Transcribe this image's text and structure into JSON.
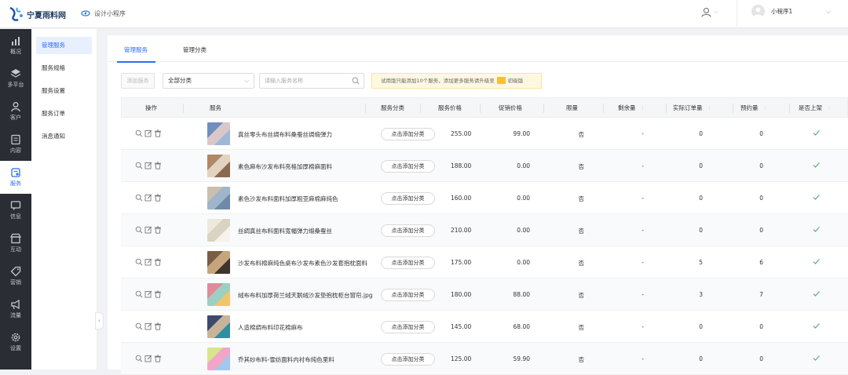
{
  "header": {
    "logo_text": "宁夏雨料网",
    "design_link": "设计小程序",
    "account_name": "小程序1"
  },
  "leftnav": [
    {
      "label": "概况",
      "icon": "chart-icon"
    },
    {
      "label": "多平台",
      "icon": "layers-icon"
    },
    {
      "label": "客户",
      "icon": "user-icon"
    },
    {
      "label": "内容",
      "icon": "document-icon"
    },
    {
      "label": "服务",
      "icon": "service-icon",
      "active": true
    },
    {
      "label": "信息",
      "icon": "message-icon"
    },
    {
      "label": "互动",
      "icon": "store-icon"
    },
    {
      "label": "营销",
      "icon": "tag-icon"
    },
    {
      "label": "流量",
      "icon": "megaphone-icon"
    },
    {
      "label": "设置",
      "icon": "gear-icon"
    }
  ],
  "subnav": [
    "管理服务",
    "服务规格",
    "服务设置",
    "服务订单",
    "消息通知"
  ],
  "tabs": [
    "管理服务",
    "管理分类"
  ],
  "toolbar": {
    "add_label": "添加服务",
    "select_value": "全部分类",
    "search_placeholder": "请输入服务名称",
    "notice_text": "试用版只能添加10个服务，添加更多服务请升级至",
    "notice_badge": "初级版"
  },
  "table": {
    "columns": [
      "操作",
      "服务",
      "服务分类",
      "服务价格",
      "促销价格",
      "限量",
      "剩余量",
      "实际订单量",
      "预约量",
      "是否上架"
    ],
    "category_button": "点击添加分类",
    "rows": [
      {
        "name": "真丝零头布丝绸布料桑蚕丝绸缎弹力",
        "price": "255.00",
        "promo": "99.00",
        "limit": "否",
        "remain": "-",
        "orders": "0",
        "booked": "0"
      },
      {
        "name": "素色麻布沙发布料亮格加厚棉麻面料",
        "price": "188.00",
        "promo": "0.00",
        "limit": "否",
        "remain": "-",
        "orders": "0",
        "booked": "0"
      },
      {
        "name": "素色沙发布料面料加厚粗亚麻棉麻纯色",
        "price": "160.00",
        "promo": "0.00",
        "limit": "否",
        "remain": "-",
        "orders": "0",
        "booked": "0"
      },
      {
        "name": "丝绸真丝布料面料宽幅弹力缎桑蚕丝",
        "price": "210.00",
        "promo": "0.00",
        "limit": "否",
        "remain": "-",
        "orders": "0",
        "booked": "0"
      },
      {
        "name": "沙发布料棉麻纯色桌布沙发布素色沙发套抱枕面料",
        "price": "175.00",
        "promo": "0.00",
        "limit": "否",
        "remain": "-",
        "orders": "5",
        "booked": "6"
      },
      {
        "name": "绒布布料加厚荷兰绒天鹅绒沙发垫抱枕柜台窗帘.jpg",
        "price": "180.00",
        "promo": "88.00",
        "limit": "否",
        "remain": "-",
        "orders": "3",
        "booked": "7"
      },
      {
        "name": "人造棉绸布料印花棉麻布",
        "price": "145.00",
        "promo": "68.00",
        "limit": "否",
        "remain": "-",
        "orders": "0",
        "booked": "0"
      },
      {
        "name": "乔其纱布料-雪纺面料内衬布纯色里料",
        "price": "125.00",
        "promo": "59.90",
        "limit": "否",
        "remain": "-",
        "orders": "0",
        "booked": "0"
      }
    ]
  }
}
